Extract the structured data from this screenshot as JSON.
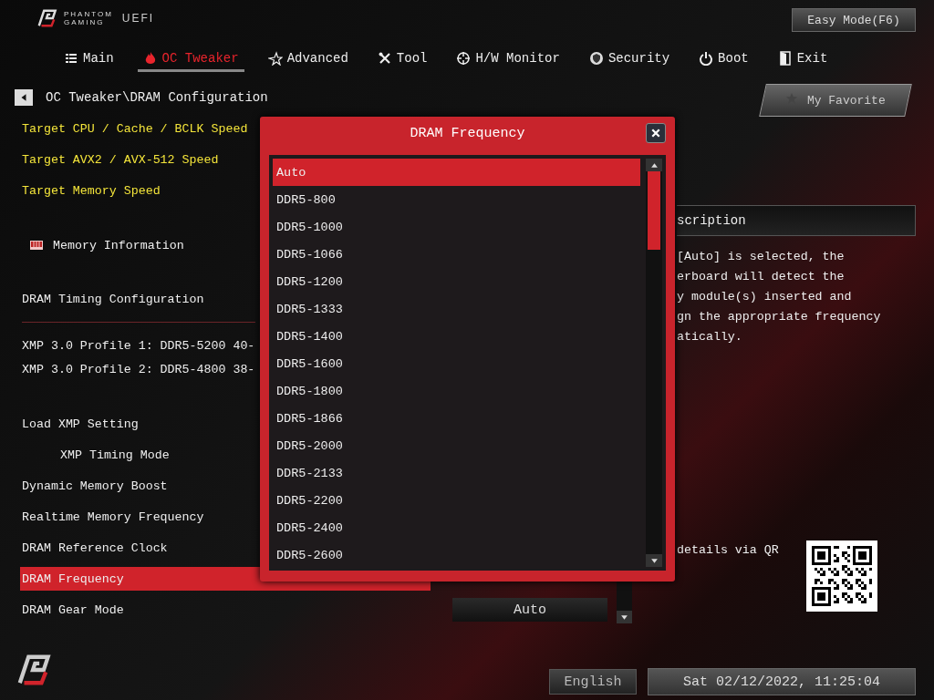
{
  "header": {
    "brand_top": "PHANTOM",
    "brand_bottom": "GAMING",
    "brand_suffix": "UEFI",
    "mode_button": "Easy Mode(F6)"
  },
  "tabs": [
    {
      "label": "Main",
      "selected": false
    },
    {
      "label": "OC Tweaker",
      "selected": true
    },
    {
      "label": "Advanced",
      "selected": false
    },
    {
      "label": "Tool",
      "selected": false
    },
    {
      "label": "H/W Monitor",
      "selected": false
    },
    {
      "label": "Security",
      "selected": false
    },
    {
      "label": "Boot",
      "selected": false
    },
    {
      "label": "Exit",
      "selected": false
    }
  ],
  "breadcrumb": "OC Tweaker\\DRAM Configuration",
  "favorite_button": "My Favorite",
  "settings": [
    {
      "kind": "target",
      "label": "Target CPU / Cache / BCLK Speed",
      "selected": false
    },
    {
      "kind": "target",
      "label": "Target AVX2 / AVX-512 Speed",
      "selected": false
    },
    {
      "kind": "target",
      "label": "Target Memory Speed",
      "selected": false
    },
    {
      "kind": "info",
      "label": "Memory Information",
      "selected": false
    },
    {
      "kind": "section",
      "label": "DRAM Timing Configuration",
      "selected": false
    },
    {
      "kind": "profile",
      "label": "XMP 3.0 Profile 1: DDR5-5200 40-",
      "selected": false
    },
    {
      "kind": "profile",
      "label": "XMP 3.0 Profile 2: DDR5-4800 38-",
      "selected": false
    },
    {
      "kind": "item",
      "label": "Load XMP Setting",
      "selected": false
    },
    {
      "kind": "subitem",
      "label": "XMP Timing Mode",
      "selected": false
    },
    {
      "kind": "item",
      "label": "Dynamic Memory Boost",
      "selected": false
    },
    {
      "kind": "item",
      "label": "Realtime Memory Frequency",
      "selected": false
    },
    {
      "kind": "item",
      "label": "DRAM Reference Clock",
      "selected": false
    },
    {
      "kind": "item",
      "label": "DRAM Frequency",
      "selected": true
    },
    {
      "kind": "item",
      "label": "DRAM Gear Mode",
      "selected": false,
      "value": "Auto"
    }
  ],
  "description": {
    "title": "scription",
    "lines": [
      "[Auto] is selected, the",
      "erboard will detect the",
      "y module(s) inserted and",
      "gn the appropriate frequency",
      "atically."
    ]
  },
  "qr_text": "details via QR",
  "dialog": {
    "title": "DRAM Frequency",
    "options": [
      {
        "label": "Auto",
        "selected": true
      },
      {
        "label": "DDR5-800",
        "selected": false
      },
      {
        "label": "DDR5-1000",
        "selected": false
      },
      {
        "label": "DDR5-1066",
        "selected": false
      },
      {
        "label": "DDR5-1200",
        "selected": false
      },
      {
        "label": "DDR5-1333",
        "selected": false
      },
      {
        "label": "DDR5-1400",
        "selected": false
      },
      {
        "label": "DDR5-1600",
        "selected": false
      },
      {
        "label": "DDR5-1800",
        "selected": false
      },
      {
        "label": "DDR5-1866",
        "selected": false
      },
      {
        "label": "DDR5-2000",
        "selected": false
      },
      {
        "label": "DDR5-2133",
        "selected": false
      },
      {
        "label": "DDR5-2200",
        "selected": false
      },
      {
        "label": "DDR5-2400",
        "selected": false
      },
      {
        "label": "DDR5-2600",
        "selected": false
      }
    ]
  },
  "footer": {
    "language": "English",
    "datetime": "Sat 02/12/2022, 11:25:04"
  }
}
